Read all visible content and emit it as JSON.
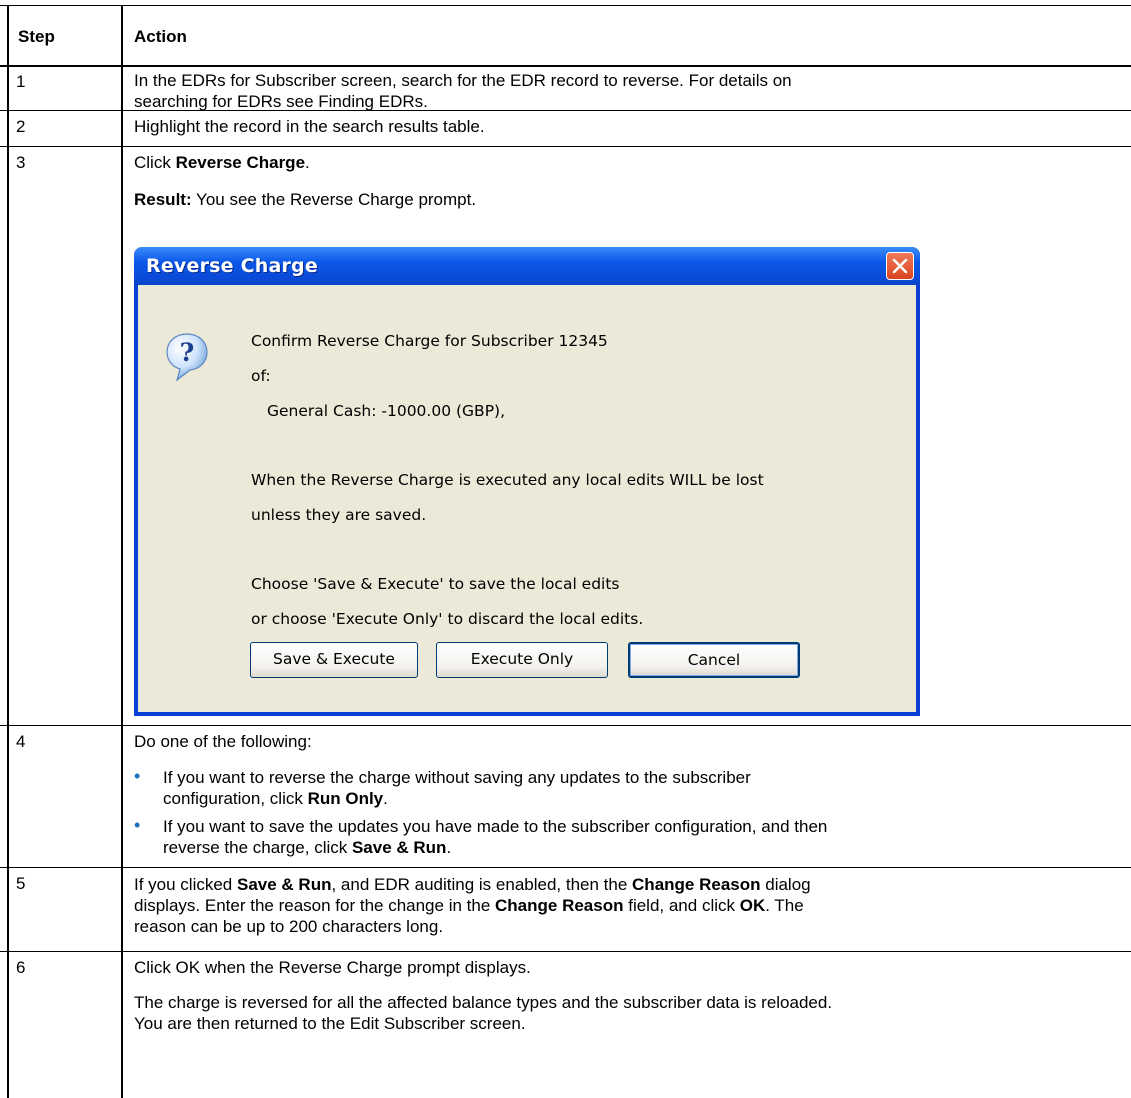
{
  "table": {
    "headers": [
      "Step",
      "Action"
    ],
    "rows": [
      {
        "step": "1",
        "text": [
          "In the EDRs for Subscriber screen, search for the EDR record to reverse. For details on",
          "searching for EDRs see Finding EDRs."
        ]
      },
      {
        "step": "2",
        "text": [
          "Highlight the record in the search results table."
        ]
      },
      {
        "step": "3",
        "click_prefix": "Click ",
        "click_bold": "Reverse Charge",
        "click_suffix": ".",
        "result_bold": "Result:",
        "result_text": " You see the Reverse Charge prompt."
      },
      {
        "step": "4",
        "intro": "Do one of the following:",
        "bullets": [
          {
            "line1": "If you want to reverse the charge without saving any updates to the subscriber",
            "line2_prefix": "configuration, click ",
            "line2_bold": "Run Only",
            "line2_suffix": "."
          },
          {
            "line1": "If you want to save the updates you have made to the subscriber configuration, and then",
            "line2_prefix": "reverse the charge, click ",
            "line2_bold": "Save & Run",
            "line2_suffix": "."
          }
        ]
      },
      {
        "step": "5",
        "l1a": "If you clicked ",
        "l1b": "Save & Run",
        "l1c": ", and EDR auditing is enabled, then the ",
        "l1d": "Change Reason",
        "l1e": " dialog",
        "l2a": "displays. Enter the reason for the change in the ",
        "l2b": "Change Reason",
        "l2c": " field, and click ",
        "l2d": "OK",
        "l2e": ". The",
        "l3": "reason can be up to 200 characters long."
      },
      {
        "step": "6",
        "text1": "Click OK when the Reverse Charge prompt displays.",
        "text2": [
          "The charge is reversed for all the affected balance types and the subscriber data is reloaded.",
          "You are then returned to the Edit Subscriber screen."
        ]
      }
    ]
  },
  "dialog": {
    "title": "Reverse Charge",
    "icon": "question-icon",
    "lines": [
      "Confirm Reverse Charge for Subscriber 12345",
      "of:",
      "General Cash: -1000.00 (GBP),",
      "When the Reverse Charge is executed any local edits WILL be lost",
      "unless they are saved.",
      "Choose 'Save & Execute' to save the local edits",
      "or choose 'Execute Only' to discard the local edits."
    ],
    "buttons": {
      "save_execute": "Save & Execute",
      "execute_only": "Execute Only",
      "cancel": "Cancel"
    }
  },
  "colors": {
    "bullet": "#1f6fbf",
    "titlebar": "#0b57e8",
    "dialog_body": "#ece9d8"
  }
}
